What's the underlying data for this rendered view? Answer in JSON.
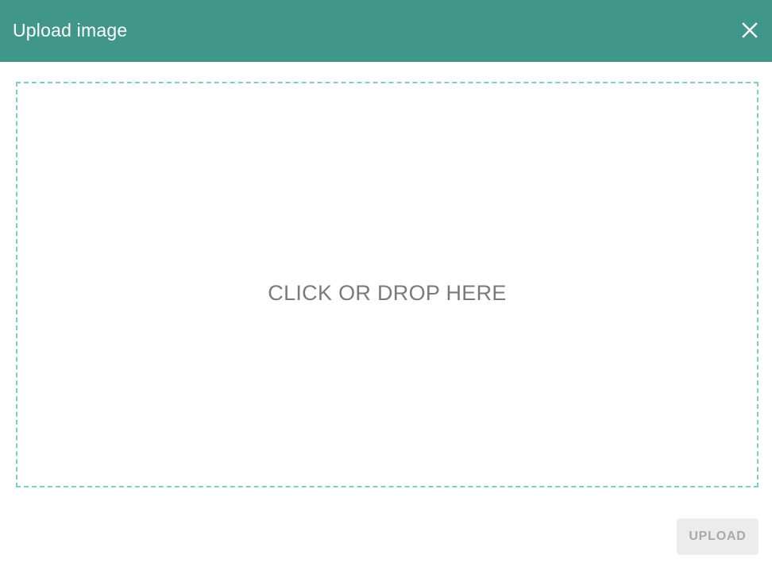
{
  "dialog": {
    "title": "Upload image",
    "close_icon": "close-icon",
    "dropzone_label": "CLICK OR DROP HERE",
    "upload_label": "UPLOAD",
    "upload_disabled": true
  },
  "colors": {
    "header_bg": "#409688",
    "dropzone_border": "#7fcdc3",
    "dropzone_text": "#7a7a7a",
    "button_bg_disabled": "#ececec",
    "button_text_disabled": "#a9a9a9"
  }
}
